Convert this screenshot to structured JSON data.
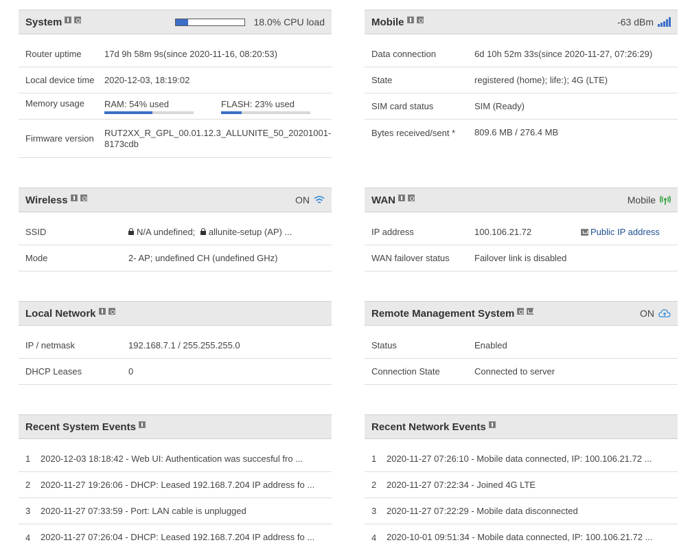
{
  "system": {
    "title": "System",
    "cpu_load_value": 18.0,
    "cpu_load_text": "18.0% CPU load",
    "rows": {
      "uptime_label": "Router uptime",
      "uptime_value": "17d 9h 58m 9s(since 2020-11-16, 08:20:53)",
      "time_label": "Local device time",
      "time_value": "2020-12-03, 18:19:02",
      "memory_label": "Memory usage",
      "ram_text": "RAM: 54% used",
      "ram_percent": 54,
      "flash_text": "FLASH: 23% used",
      "flash_percent": 23,
      "firmware_label": "Firmware version",
      "firmware_value": "RUT2XX_R_GPL_00.01.12.3_ALLUNITE_50_20201001-8173cdb"
    }
  },
  "mobile": {
    "title": "Mobile",
    "signal_text": "-63 dBm",
    "rows": {
      "data_label": "Data connection",
      "data_value": "6d 10h 52m 33s(since 2020-11-27, 07:26:29)",
      "state_label": "State",
      "state_value": "registered (home); life:); 4G (LTE)",
      "sim_label": "SIM card status",
      "sim_value": "SIM (Ready)",
      "bytes_label": "Bytes received/sent *",
      "bytes_value": "809.6 MB / 276.4 MB"
    }
  },
  "wireless": {
    "title": "Wireless",
    "status": "ON",
    "rows": {
      "ssid_label": "SSID",
      "ssid_1": "N/A undefined;",
      "ssid_2": "allunite-setup (AP) ...",
      "mode_label": "Mode",
      "mode_value": "2- AP; undefined CH (undefined GHz)"
    }
  },
  "wan": {
    "title": "WAN",
    "status": "Mobile",
    "rows": {
      "ip_label": "IP address",
      "ip_value": "100.106.21.72",
      "public_ip_link": "Public IP address",
      "failover_label": "WAN failover status",
      "failover_value": "Failover link is disabled"
    }
  },
  "local_network": {
    "title": "Local Network",
    "rows": {
      "ip_label": "IP / netmask",
      "ip_value": "192.168.7.1 / 255.255.255.0",
      "dhcp_label": "DHCP Leases",
      "dhcp_value": "0"
    }
  },
  "rms": {
    "title": "Remote Management System",
    "status": "ON",
    "rows": {
      "status_label": "Status",
      "status_value": "Enabled",
      "conn_label": "Connection State",
      "conn_value": "Connected to server"
    }
  },
  "system_events": {
    "title": "Recent System Events",
    "items": [
      {
        "num": "1",
        "text": "2020-12-03 18:18:42 - Web UI: Authentication was succesful fro ..."
      },
      {
        "num": "2",
        "text": "2020-11-27 19:26:06 - DHCP: Leased 192.168.7.204 IP address fo ..."
      },
      {
        "num": "3",
        "text": "2020-11-27 07:33:59 - Port: LAN cable is unplugged"
      },
      {
        "num": "4",
        "text": "2020-11-27 07:26:04 - DHCP: Leased 192.168.7.204 IP address fo ..."
      }
    ]
  },
  "network_events": {
    "title": "Recent Network Events",
    "items": [
      {
        "num": "1",
        "text": "2020-11-27 07:26:10 - Mobile data connected, IP: 100.106.21.72 ..."
      },
      {
        "num": "2",
        "text": "2020-11-27 07:22:34 - Joined 4G LTE"
      },
      {
        "num": "3",
        "text": "2020-11-27 07:22:29 - Mobile data disconnected"
      },
      {
        "num": "4",
        "text": "2020-10-01 09:51:34 - Mobile data connected, IP: 100.106.21.72 ..."
      }
    ]
  },
  "colors": {
    "accent": "#3b6fc7",
    "header_bg": "#e9e9e9",
    "link": "#1e4f91",
    "wan_green": "#2e9e3a"
  },
  "icons": [
    "info-icon",
    "settings-icon",
    "wiki-icon",
    "signal-bars-icon",
    "wifi-icon",
    "antenna-icon",
    "cloud-icon",
    "lock-icon"
  ]
}
